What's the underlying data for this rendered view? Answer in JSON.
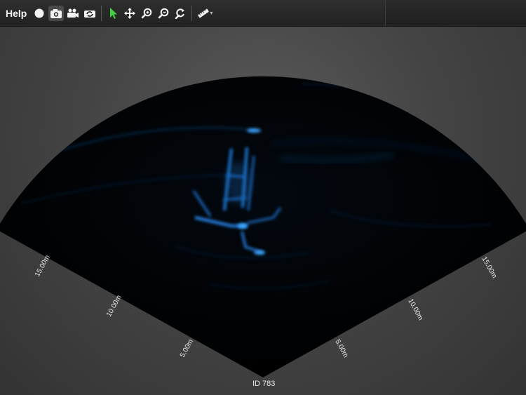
{
  "toolbar": {
    "help_label": "Help",
    "buttons": [
      {
        "name": "record-icon"
      },
      {
        "name": "camera-icon"
      },
      {
        "name": "video-camera-icon"
      },
      {
        "name": "camera-switch-icon"
      },
      {
        "name": "pointer-select-icon"
      },
      {
        "name": "pan-move-icon"
      },
      {
        "name": "zoom-in-icon"
      },
      {
        "name": "zoom-out-icon"
      },
      {
        "name": "reset-view-icon"
      },
      {
        "name": "ruler-icon"
      }
    ]
  },
  "sonar": {
    "left_ranges": [
      "5.00m",
      "10.00m",
      "15.00m"
    ],
    "right_ranges": [
      "5.00m",
      "10.00m",
      "15.00m"
    ],
    "id_label": "ID 783"
  },
  "colors": {
    "accent_green": "#3fd13f",
    "sonar_blue": "#2a9cff",
    "fan_bg": "#000000"
  }
}
